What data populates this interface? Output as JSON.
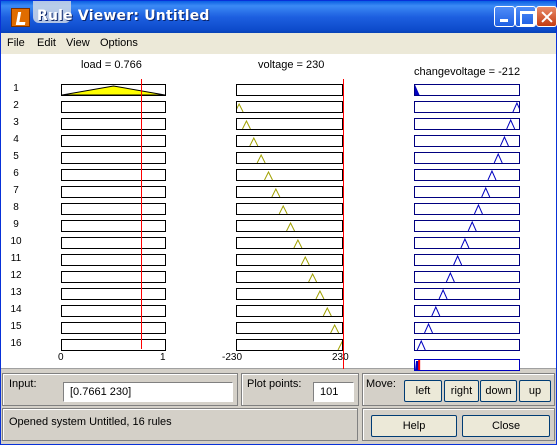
{
  "window": {
    "title": "Rule Viewer: Untitled",
    "colors": {
      "titlebar": "#0a5fe3",
      "mf_input": "#ffff00",
      "mf_line_input": "#a0a000",
      "mf_output": "#0000c0",
      "index_line": "#ff0000"
    }
  },
  "menu": {
    "items": [
      "File",
      "Edit",
      "View",
      "Options"
    ]
  },
  "variables": {
    "load": {
      "title": "load = 0.766",
      "range_min": "0",
      "range_max": "1",
      "value": 0.766
    },
    "voltage": {
      "title": "voltage = 230",
      "range_min": "-230",
      "range_max": "230",
      "value": 230
    },
    "changevoltage": {
      "title": "changevoltage = -212"
    }
  },
  "rules": [
    "1",
    "2",
    "3",
    "4",
    "5",
    "6",
    "7",
    "8",
    "9",
    "10",
    "11",
    "12",
    "13",
    "14",
    "15",
    "16"
  ],
  "mf_positions": {
    "voltage_peaks": [
      null,
      0.02,
      0.09,
      0.16,
      0.23,
      0.3,
      0.37,
      0.44,
      0.51,
      0.58,
      0.65,
      0.72,
      0.79,
      0.86,
      0.93,
      1.0
    ],
    "changevoltage_peaks": [
      0.0,
      0.98,
      0.92,
      0.86,
      0.8,
      0.74,
      0.68,
      0.61,
      0.55,
      0.48,
      0.41,
      0.34,
      0.27,
      0.2,
      0.13,
      0.06
    ],
    "aggregate_level": 0.04
  },
  "bottom": {
    "input_label": "Input:",
    "input_value": "[0.7661 230]",
    "plot_points_label": "Plot points:",
    "plot_points_value": "101",
    "move_label": "Move:",
    "move_left": "left",
    "move_right": "right",
    "move_down": "down",
    "move_up": "up",
    "status": "Opened system Untitled, 16 rules",
    "help": "Help",
    "close": "Close"
  }
}
